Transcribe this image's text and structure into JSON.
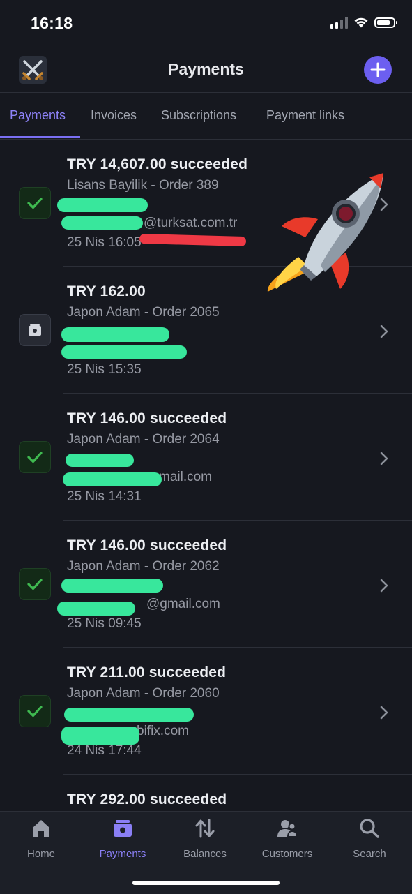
{
  "status_bar": {
    "time": "16:18",
    "battery_percent": 80
  },
  "header": {
    "title": "Payments",
    "logo_icon": "crossed-swords-icon",
    "add_icon": "plus-icon"
  },
  "tabs": [
    {
      "label": "Payments",
      "active": true
    },
    {
      "label": "Invoices",
      "active": false
    },
    {
      "label": "Subscriptions",
      "active": false
    },
    {
      "label": "Payment links",
      "active": false
    }
  ],
  "payments": [
    {
      "status": "succeeded",
      "amount": "TRY 14,607.00 succeeded",
      "description": "Lisans Bayilik - Order 389",
      "email": "@turksat.com.tr",
      "date": "25 Nis 16:05"
    },
    {
      "status": "uncaptured",
      "amount": "TRY 162.00",
      "description": "Japon Adam - Order 2065",
      "email": "",
      "date": "25 Nis 15:35"
    },
    {
      "status": "succeeded",
      "amount": "TRY 146.00 succeeded",
      "description": "Japon Adam - Order 2064",
      "email": "mail.com",
      "date": "25 Nis 14:31"
    },
    {
      "status": "succeeded",
      "amount": "TRY 146.00 succeeded",
      "description": "Japon Adam - Order 2062",
      "email": "@gmail.com",
      "date": "25 Nis 09:45"
    },
    {
      "status": "succeeded",
      "amount": "TRY 211.00 succeeded",
      "description": "Japon Adam - Order 2060",
      "email": "bifix.com",
      "date": "24 Nis 17:44"
    },
    {
      "status": "succeeded",
      "amount": "TRY 292.00 succeeded",
      "description": "",
      "email": "",
      "date": ""
    }
  ],
  "tab_bar": {
    "items": [
      {
        "label": "Home",
        "icon": "home-icon",
        "active": false
      },
      {
        "label": "Payments",
        "icon": "payments-icon",
        "active": true
      },
      {
        "label": "Balances",
        "icon": "balances-icon",
        "active": false
      },
      {
        "label": "Customers",
        "icon": "customers-icon",
        "active": false
      },
      {
        "label": "Search",
        "icon": "search-icon",
        "active": false
      }
    ]
  },
  "colors": {
    "background": "#16181f",
    "accent": "#7a6ff3",
    "success_green": "#3fb950",
    "redaction_green": "#38e79c",
    "redaction_red": "#ef3945"
  }
}
